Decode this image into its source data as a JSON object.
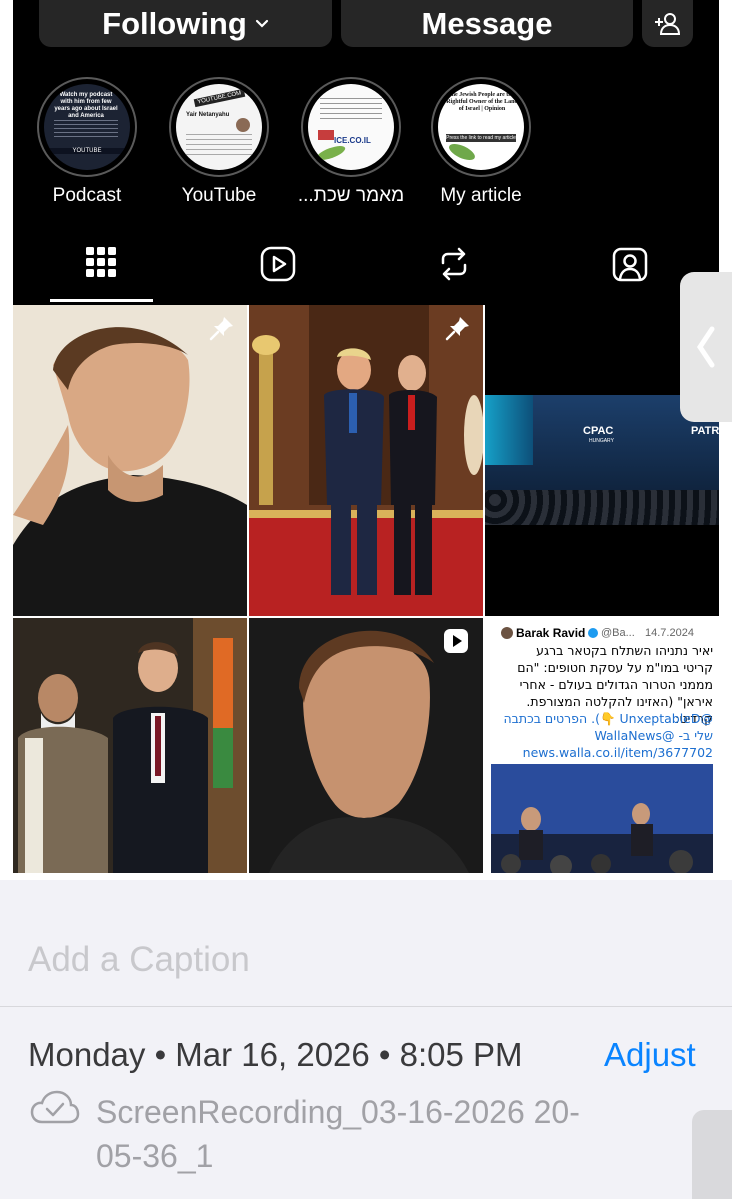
{
  "profile": {
    "following_label": "Following",
    "message_label": "Message",
    "add_user_icon": "person-plus-icon"
  },
  "highlights": [
    {
      "label": "Podcast"
    },
    {
      "label": "YouTube"
    },
    {
      "label": "...מאמר שכת"
    },
    {
      "label": "My article"
    }
  ],
  "highlight_thumbs": {
    "podcast_text": "Watch my podcast with him from few years ago about Israel and America",
    "podcast_footer": "YOUTUBE",
    "youtube_header": "YOUTUBE.COM",
    "youtube_name": "Yair Netanyahu",
    "article_footer": "ICE.CO.IL",
    "myarticle_title": "the Jewish People are the Rightful Owner of the Land of Israel | Opinion",
    "myarticle_button": "Press the link to read my article"
  },
  "tabs": [
    {
      "name": "grid",
      "icon": "grid-icon",
      "selected": true
    },
    {
      "name": "reels",
      "icon": "reels-icon",
      "selected": false
    },
    {
      "name": "reposts",
      "icon": "repost-icon",
      "selected": false
    },
    {
      "name": "tagged",
      "icon": "tagged-user-icon",
      "selected": false
    }
  ],
  "posts": {
    "stage_banner": "PATR",
    "stage_logo": "CPAC",
    "stage_sub": "HUNGARY",
    "tweet_author": "Barak Ravid",
    "tweet_handle": "@Ba...",
    "tweet_date": "14.7.2024",
    "tweet_body_1": "יאיר נתניהו השתלח בקטאר ברגע",
    "tweet_body_2": "קריטי במו\"מ על עסקת חטופים: \"הם",
    "tweet_body_3": "מממני הטרור הגדולים בעולם - אחרי",
    "tweet_body_4": "איראן\" (האזינו להקלטה המצורפת. קרדיט:",
    "tweet_body_5": "@UnxeptableD 👇). הפרטים בכתבה",
    "tweet_body_6": "שלי ב- @WallaNews",
    "tweet_link": "news.walla.co.il/item/3677702"
  },
  "caption": {
    "placeholder": "Add a Caption"
  },
  "info": {
    "datetime": "Monday • Mar 16, 2026 • 8:05 PM",
    "adjust_label": "Adjust",
    "filename": "ScreenRecording_03-16-2026 20-05-36_1",
    "cloud_icon": "icloud-check-icon"
  },
  "colors": {
    "accent": "#0a84ff",
    "ig_background": "#000000",
    "button_bg": "#262626"
  }
}
